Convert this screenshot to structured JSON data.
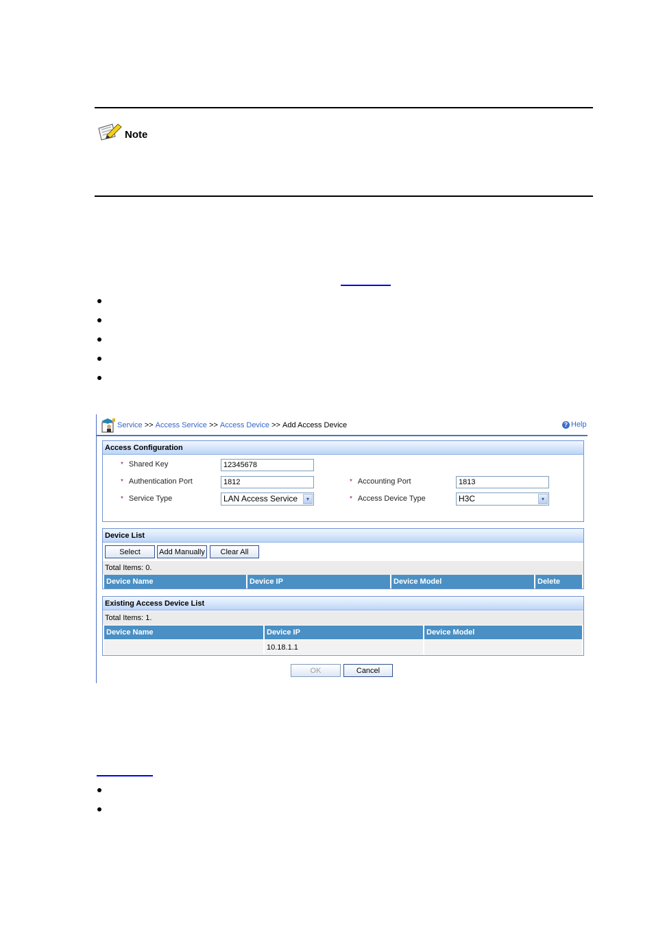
{
  "note": {
    "label": "Note",
    "icon": "note-pencil-icon"
  },
  "ui": {
    "breadcrumb": {
      "items": [
        {
          "label": "Service",
          "link": true
        },
        {
          "label": ">>",
          "link": false
        },
        {
          "label": "Access Service",
          "link": true
        },
        {
          "label": ">>",
          "link": false
        },
        {
          "label": "Access Device",
          "link": true
        },
        {
          "label": ">>",
          "link": false
        },
        {
          "label": "Add Access Device",
          "link": false
        }
      ]
    },
    "help": {
      "icon_glyph": "?",
      "label": "Help"
    },
    "access_configuration": {
      "title": "Access Configuration",
      "required_mark": "*",
      "shared_key": {
        "label": "Shared Key",
        "value": "12345678"
      },
      "authentication_port": {
        "label": "Authentication Port",
        "value": "1812"
      },
      "accounting_port": {
        "label": "Accounting Port",
        "value": "1813"
      },
      "service_type": {
        "label": "Service Type",
        "value": "LAN Access Service"
      },
      "access_device_type": {
        "label": "Access Device Type",
        "value": "H3C"
      },
      "dropdown_glyph": "▾"
    },
    "device_list": {
      "title": "Device List",
      "buttons": {
        "select": "Select",
        "add_manually": "Add Manually",
        "clear_all": "Clear All"
      },
      "total": "Total Items: 0.",
      "columns": [
        "Device Name",
        "Device IP",
        "Device Model",
        "Delete"
      ]
    },
    "existing_list": {
      "title": "Existing Access Device List",
      "total": "Total Items: 1.",
      "columns": [
        "Device Name",
        "Device IP",
        "Device Model"
      ],
      "rows": [
        [
          "",
          "10.18.1.1",
          ""
        ]
      ]
    },
    "actions": {
      "ok": "OK",
      "cancel": "Cancel"
    }
  },
  "colors": {
    "link": "#3366cc",
    "header_blue": "#4a90c4",
    "panel_border": "#6f94d4",
    "required": "#8b0a6e",
    "doc_link": "#0000ee"
  }
}
